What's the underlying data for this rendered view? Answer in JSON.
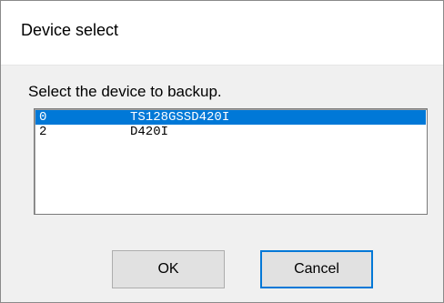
{
  "window": {
    "title": "Device select"
  },
  "prompt": "Select the device to backup.",
  "device_list": {
    "selected_index": 0,
    "items": [
      {
        "index": "0",
        "name": "TS128GSSD420I"
      },
      {
        "index": "2",
        "name": "D420I"
      }
    ]
  },
  "buttons": {
    "ok_label": "OK",
    "cancel_label": "Cancel"
  },
  "colors": {
    "selection": "#0078d7",
    "dialog_background": "#f0f0f0",
    "title_background": "#ffffff"
  }
}
